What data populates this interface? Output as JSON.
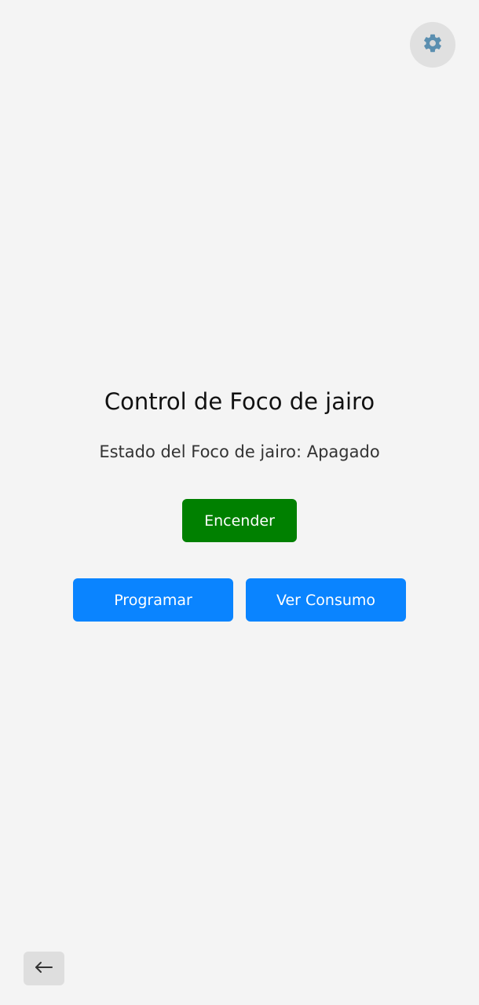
{
  "header": {
    "settings_icon": "gear-icon"
  },
  "main": {
    "title": "Control de Foco de jairo",
    "status_text": "Estado del Foco de jairo: Apagado",
    "toggle_label": "Encender",
    "schedule_label": "Programar",
    "consumption_label": "Ver Consumo"
  },
  "footer": {
    "back_icon": "arrow-left-icon"
  },
  "colors": {
    "background": "#f4f4f4",
    "toggle_on": "#008000",
    "primary": "#0a84ff",
    "icon_button_bg": "#e0e0e0"
  }
}
